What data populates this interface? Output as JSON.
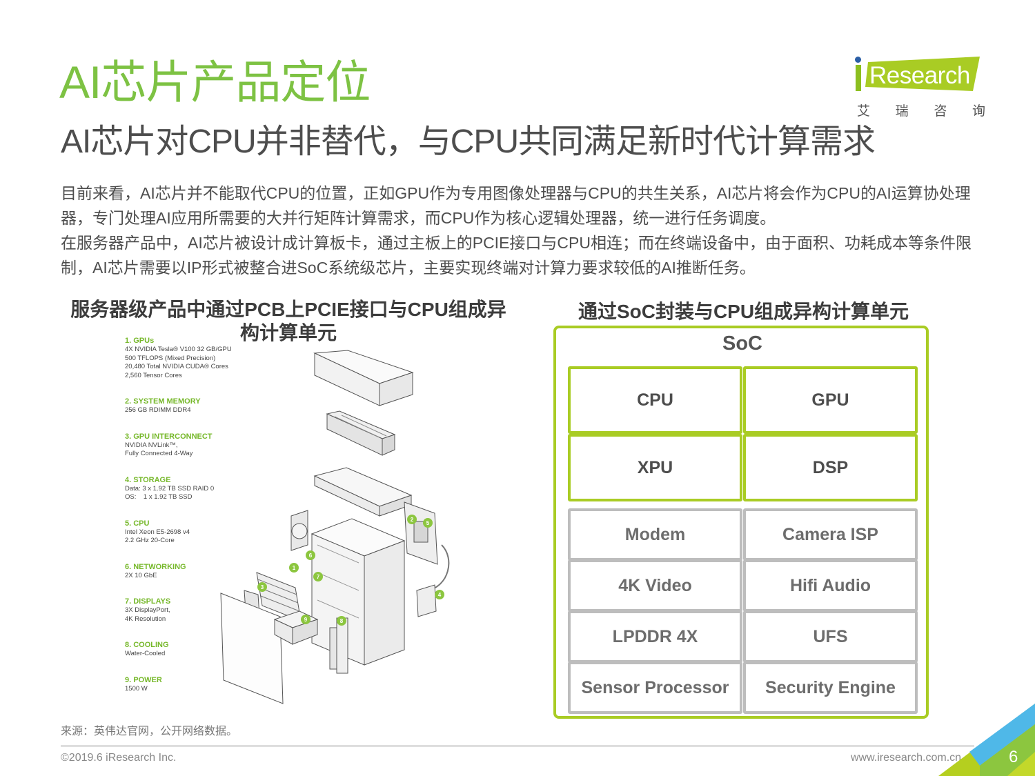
{
  "header": {
    "title": "AI芯片产品定位",
    "subtitle": "AI芯片对CPU并非替代，与CPU共同满足新时代计算需求"
  },
  "logo": {
    "brand": "Research",
    "brand_prefix": "i",
    "chinese": [
      "艾",
      "瑞",
      "咨",
      "询"
    ],
    "colors": {
      "green": "#a9cc24",
      "blue": "#2a5ea6"
    }
  },
  "intro": {
    "paragraphs": [
      "目前来看，AI芯片并不能取代CPU的位置，正如GPU作为专用图像处理器与CPU的共生关系，AI芯片将会作为CPU的AI运算协处理器，专门处理AI应用所需要的大并行矩阵计算需求，而CPU作为核心逻辑处理器，统一进行任务调度。",
      "在服务器产品中，AI芯片被设计成计算板卡，通过主板上的PCIE接口与CPU相连；而在终端设备中，由于面积、功耗成本等条件限制，AI芯片需要以IP形式被整合进SoC系统级芯片，主要实现终端对计算力要求较低的AI推断任务。"
    ]
  },
  "left_panel": {
    "heading": "服务器级产品中通过PCB上PCIE接口与CPU组成异构计算单元",
    "specs": [
      {
        "title": "1. GPUs",
        "lines": [
          "4X NVIDIA Tesla® V100 32 GB/GPU",
          "500 TFLOPS (Mixed Precision)",
          "20,480 Total NVIDIA CUDA® Cores",
          "2,560 Tensor Cores"
        ]
      },
      {
        "title": "2. SYSTEM MEMORY",
        "lines": [
          "256 GB RDIMM DDR4"
        ]
      },
      {
        "title": "3. GPU INTERCONNECT",
        "lines": [
          "NVIDIA NVLink™,",
          "Fully Connected 4-Way"
        ]
      },
      {
        "title": "4. STORAGE",
        "lines": [
          "Data: 3 x 1.92 TB SSD RAID 0",
          "OS:    1 x 1.92 TB SSD"
        ]
      },
      {
        "title": "5. CPU",
        "lines": [
          "Intel Xeon E5-2698 v4",
          "2.2 GHz 20-Core"
        ]
      },
      {
        "title": "6. NETWORKING",
        "lines": [
          "2X 10 GbE"
        ]
      },
      {
        "title": "7. DISPLAYS",
        "lines": [
          "3X DisplayPort,",
          "4K Resolution"
        ]
      },
      {
        "title": "8. COOLING",
        "lines": [
          "Water-Cooled"
        ]
      },
      {
        "title": "9. POWER",
        "lines": [
          "1500 W"
        ]
      }
    ],
    "callouts": [
      "1",
      "2",
      "3",
      "4",
      "5",
      "6",
      "7",
      "8",
      "9"
    ]
  },
  "right_panel": {
    "heading": "通过SoC封装与CPU组成异构计算单元",
    "soc_label": "SoC",
    "core_units": [
      "CPU",
      "GPU",
      "XPU",
      "DSP"
    ],
    "peripheral_units": [
      "Modem",
      "Camera ISP",
      "4K Video",
      "Hifi Audio",
      "LPDDR 4X",
      "UFS",
      "Sensor Processor",
      "Security Engine"
    ],
    "colors": {
      "core_border": "#a9cc24",
      "peripheral_border": "#bdbdbd"
    }
  },
  "footer": {
    "source": "来源：英伟达官网，公开网络数据。",
    "copyright": "©2019.6 iResearch Inc.",
    "website": "www.iresearch.com.cn",
    "page_number": "6"
  }
}
